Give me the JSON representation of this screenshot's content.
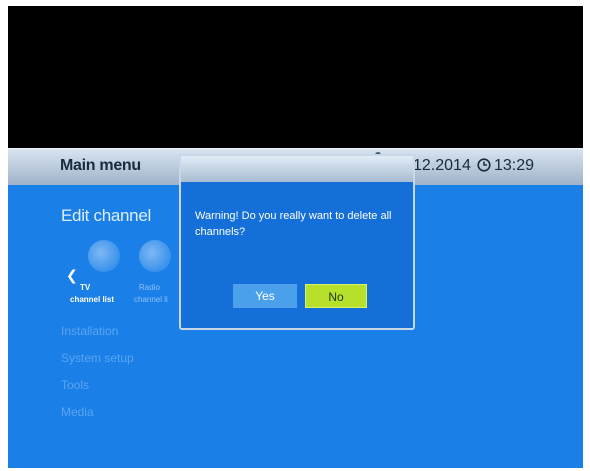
{
  "header": {
    "title": "Main menu",
    "date": "12.2014",
    "time": "13:29"
  },
  "menu": {
    "title": "Edit channel",
    "submenu": [
      {
        "name": "TV",
        "label": "channel list"
      },
      {
        "name": "Radio",
        "label": "channel li"
      }
    ],
    "items": [
      "Installation",
      "System setup",
      "Tools",
      "Media"
    ]
  },
  "dialog": {
    "message": "Warning! Do you really want to delete all channels?",
    "yes_label": "Yes",
    "no_label": "No"
  },
  "colors": {
    "osd_background": "#1b7fe8",
    "selected_button": "#b7e02a",
    "unselected_button": "#4aa0ea"
  }
}
